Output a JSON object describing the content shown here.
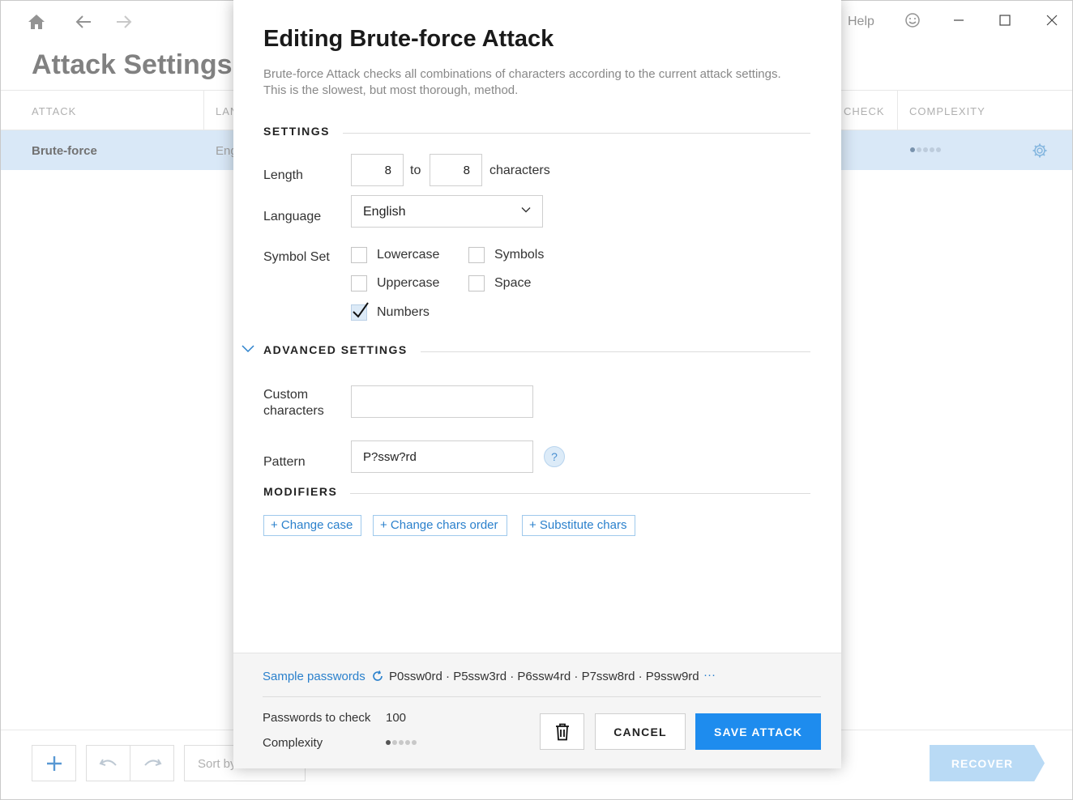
{
  "app": {
    "page_title": "Attack Settings",
    "help_label": "Help",
    "table": {
      "columns": [
        "ATTACK",
        "LAN",
        "CHECK",
        "COMPLEXITY"
      ],
      "row": {
        "name": "Brute-force",
        "language": "Eng",
        "complexity_level": 1,
        "complexity_max": 5
      }
    },
    "sort_placeholder": "Sort by",
    "recover_label": "RECOVER"
  },
  "dialog": {
    "title": "Editing Brute-force Attack",
    "description": "Brute-force Attack checks all combinations of characters according to the current attack settings. This is the slowest, but most thorough, method.",
    "settings": {
      "heading": "SETTINGS",
      "length_label": "Length",
      "length_from": "8",
      "to_label": "to",
      "length_to": "8",
      "characters_label": "characters",
      "language_label": "Language",
      "language_value": "English",
      "symbol_set_label": "Symbol Set",
      "symbols": {
        "lowercase": {
          "label": "Lowercase",
          "checked": false
        },
        "symbols": {
          "label": "Symbols",
          "checked": false
        },
        "uppercase": {
          "label": "Uppercase",
          "checked": false
        },
        "space": {
          "label": "Space",
          "checked": false
        },
        "numbers": {
          "label": "Numbers",
          "checked": true
        }
      }
    },
    "advanced": {
      "heading": "ADVANCED SETTINGS",
      "custom_label_line1": "Custom",
      "custom_label_line2": "characters",
      "custom_value": "",
      "pattern_label": "Pattern",
      "pattern_value": "P?ssw?rd",
      "help_badge": "?"
    },
    "modifiers": {
      "heading": "MODIFIERS",
      "buttons": [
        "+ Change case",
        "+ Change chars order",
        "+ Substitute chars"
      ]
    },
    "footer": {
      "sample_label": "Sample passwords",
      "samples": "P0ssw0rd · P5ssw3rd · P6ssw4rd · P7ssw8rd · P9ssw9rd",
      "more": "···",
      "passwords_label": "Passwords to check",
      "passwords_value": "100",
      "complexity_label": "Complexity",
      "complexity_level": 1,
      "complexity_max": 5,
      "cancel_label": "CANCEL",
      "save_label": "SAVE ATTACK"
    }
  },
  "colors": {
    "accent": "#1e8cee",
    "link": "#2a80cc",
    "row_highlight": "#d6e6f7"
  }
}
